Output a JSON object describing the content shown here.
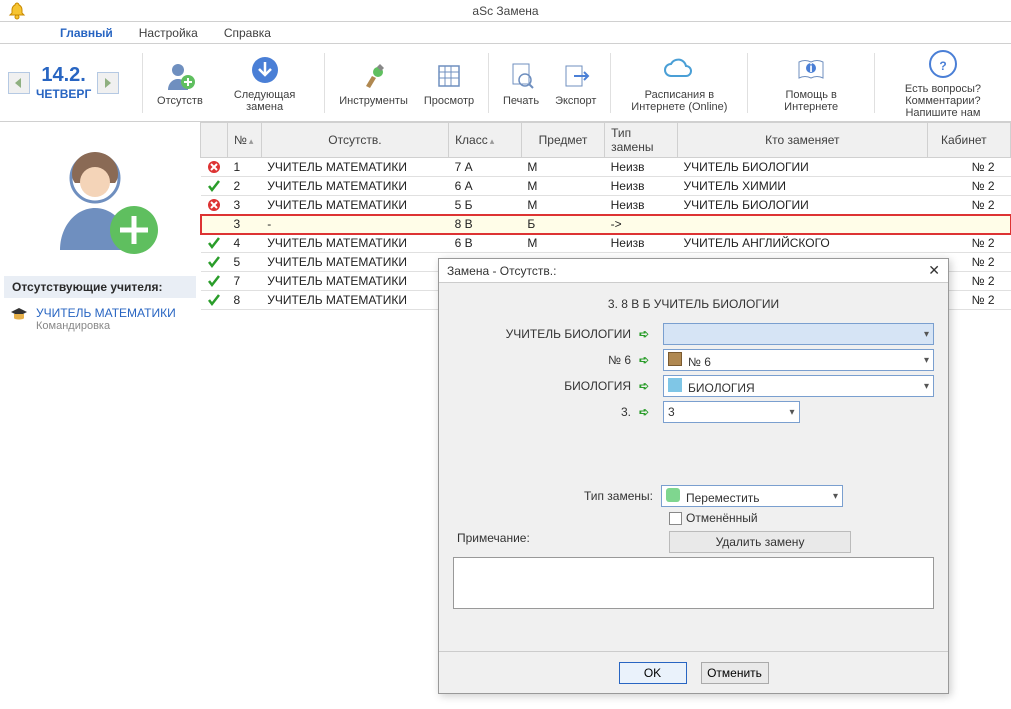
{
  "app": {
    "title": "aSc Замена"
  },
  "menu": {
    "main": "Главный",
    "settings": "Настройка",
    "help": "Справка"
  },
  "date": {
    "day": "14.2.",
    "weekday": "ЧЕТВЕРГ"
  },
  "ribbon": {
    "absence": "Отсутств",
    "next_sub": "Следующая замена",
    "tools": "Инструменты",
    "view": "Просмотр",
    "print": "Печать",
    "export": "Экспорт",
    "online": "Расписания в Интернете (Online)",
    "help_net": "Помощь в Интернете",
    "questions": "Есть вопросы? Комментарии? Напишите нам"
  },
  "sidebar": {
    "section": "Отсутствующие учителя:",
    "teacher": "УЧИТЕЛЬ МАТЕМАТИКИ",
    "reason": "Командировка"
  },
  "table": {
    "headers": {
      "num": "№",
      "abs": "Отсутств.",
      "class": "Класс",
      "subj": "Предмет",
      "type": "Тип замены",
      "rep": "Кто заменяет",
      "room": "Кабинет"
    },
    "rows": [
      {
        "status": "x",
        "n": "1",
        "abs": "УЧИТЕЛЬ МАТЕМАТИКИ",
        "cl": "7 А",
        "sub": "М",
        "typ": "Неизв",
        "rep": "УЧИТЕЛЬ БИОЛОГИИ",
        "room": "№ 2",
        "hl": false
      },
      {
        "status": "ok",
        "n": "2",
        "abs": "УЧИТЕЛЬ МАТЕМАТИКИ",
        "cl": "6 А",
        "sub": "М",
        "typ": "Неизв",
        "rep": "УЧИТЕЛЬ ХИМИИ",
        "room": "№ 2",
        "hl": false
      },
      {
        "status": "x",
        "n": "3",
        "abs": "УЧИТЕЛЬ МАТЕМАТИКИ",
        "cl": "5 Б",
        "sub": "М",
        "typ": "Неизв",
        "rep": "УЧИТЕЛЬ БИОЛОГИИ",
        "room": "№ 2",
        "hl": false
      },
      {
        "status": "",
        "n": "3",
        "abs": "-",
        "cl": "8 В",
        "sub": "Б",
        "typ": "->",
        "rep": "",
        "room": "",
        "hl": true
      },
      {
        "status": "ok",
        "n": "4",
        "abs": "УЧИТЕЛЬ МАТЕМАТИКИ",
        "cl": "6 В",
        "sub": "М",
        "typ": "Неизв",
        "rep": "УЧИТЕЛЬ АНГЛИЙСКОГО",
        "room": "№ 2",
        "hl": false
      },
      {
        "status": "ok",
        "n": "5",
        "abs": "УЧИТЕЛЬ МАТЕМАТИКИ",
        "cl": "",
        "sub": "",
        "typ": "",
        "rep": "",
        "room": "№ 2",
        "hl": false
      },
      {
        "status": "ok",
        "n": "7",
        "abs": "УЧИТЕЛЬ МАТЕМАТИКИ",
        "cl": "",
        "sub": "",
        "typ": "",
        "rep": "",
        "room": "№ 2",
        "hl": false
      },
      {
        "status": "ok",
        "n": "8",
        "abs": "УЧИТЕЛЬ МАТЕМАТИКИ",
        "cl": "",
        "sub": "",
        "typ": "",
        "rep": "",
        "room": "№ 2",
        "hl": false
      }
    ]
  },
  "dialog": {
    "title": "Замена - Отсутств.:",
    "subtitle": "3.  8 В   Б  УЧИТЕЛЬ БИОЛОГИИ",
    "teacher_label": "УЧИТЕЛЬ БИОЛОГИИ",
    "teacher_value": "",
    "room_label": "№ 6",
    "room_value": "№ 6",
    "subject_label": "БИОЛОГИЯ",
    "subject_value": "БИОЛОГИЯ",
    "period_label": "3.",
    "period_value": "3",
    "type_label": "Тип замены:",
    "type_value": "Переместить",
    "cancelled": "Отменённый",
    "note_label": "Примечание:",
    "delete": "Удалить замену",
    "ok": "OK",
    "cancel": "Отменить"
  }
}
